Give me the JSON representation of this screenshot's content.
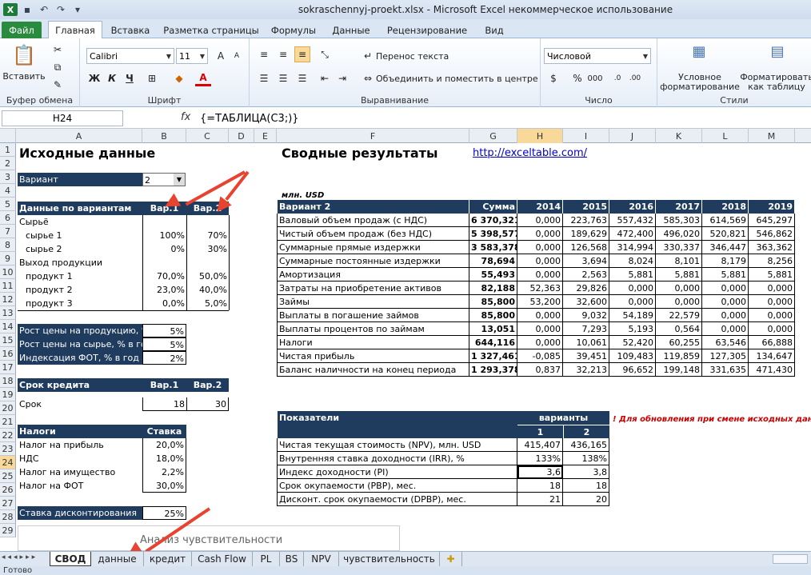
{
  "window": {
    "title": "sokraschennyj-proekt.xlsx  -  Microsoft Excel некоммерческое использование",
    "app_icon": "X"
  },
  "ribbon_tabs": [
    "Файл",
    "Главная",
    "Вставка",
    "Разметка страницы",
    "Формулы",
    "Данные",
    "Рецензирование",
    "Вид"
  ],
  "ribbon": {
    "clipboard": {
      "paste": "Вставить",
      "label": "Буфер обмена"
    },
    "font": {
      "name": "Calibri",
      "size": "11",
      "bold": "Ж",
      "italic": "К",
      "underline": "Ч",
      "color_glyph": "А",
      "label": "Шрифт"
    },
    "alignment": {
      "wrap": "Перенос текста",
      "merge": "Объединить и поместить в центре",
      "label": "Выравнивание"
    },
    "number": {
      "format": "Числовой",
      "percent": "%",
      "thousands": "000",
      "label": "Число"
    },
    "styles": {
      "conditional": "Условное",
      "conditional2": "форматирование",
      "as_table": "Форматировать",
      "as_table2": "как таблицу",
      "label": "Стили"
    }
  },
  "formula_bar": {
    "name_box": "H24",
    "fx": "fx",
    "formula": "{=ТАБЛИЦА(C3;)}"
  },
  "columns": [
    "A",
    "B",
    "C",
    "D",
    "E",
    "F",
    "G",
    "H",
    "I",
    "J",
    "K",
    "L",
    "M"
  ],
  "rows": [
    "1",
    "2",
    "3",
    "4",
    "5",
    "6",
    "7",
    "8",
    "9",
    "10",
    "11",
    "12",
    "13",
    "14",
    "15",
    "16",
    "17",
    "18",
    "19",
    "20",
    "21",
    "22",
    "23",
    "24",
    "25",
    "26",
    "27",
    "28",
    "29"
  ],
  "left": {
    "title": "Исходные данные",
    "variant_label": "Вариант",
    "variant_value": "2",
    "data_hdr": "Данные по вариантам",
    "var1": "Вар.1",
    "var2": "Вар.2",
    "raw": "Сырьё",
    "raw1": "сырье 1",
    "raw1_v1": "100%",
    "raw1_v2": "70%",
    "raw2": "сырье 2",
    "raw2_v1": "0%",
    "raw2_v2": "30%",
    "output": "Выход продукции",
    "p1": "продукт 1",
    "p1_v1": "70,0%",
    "p1_v2": "50,0%",
    "p2": "продукт 2",
    "p2_v1": "23,0%",
    "p2_v2": "40,0%",
    "p3": "продукт 3",
    "p3_v1": "0,0%",
    "p3_v2": "5,0%",
    "g1": "Рост цены на продукцию, % в год",
    "g1_v": "5%",
    "g2": "Рост цены на сырье, % в год",
    "g2_v": "5%",
    "g3": "Индексация ФОТ, % в год",
    "g3_v": "2%",
    "credit_hdr": "Срок кредита",
    "term": "Срок",
    "term_v1": "18",
    "term_v2": "30",
    "tax_hdr": "Налоги",
    "rate_hdr": "Ставка",
    "t1": "Налог на прибыль",
    "t1_v": "20,0%",
    "t2": "НДС",
    "t2_v": "18,0%",
    "t3": "Налог на имущество",
    "t3_v": "2,2%",
    "t4": "Налог на ФОТ",
    "t4_v": "30,0%",
    "disc": "Ставка дисконтирования",
    "disc_v": "25%",
    "textbox": "Анализ чувствительности"
  },
  "right": {
    "title": "Сводные результаты",
    "link": "http://exceltable.com/",
    "unit": "млн. USD",
    "hdr": [
      "Вариант 2",
      "Сумма",
      "2014",
      "2015",
      "2016",
      "2017",
      "2018",
      "2019"
    ],
    "rows": [
      [
        "Валовый объем продаж (с НДС)",
        "6 370,321",
        "0,000",
        "223,763",
        "557,432",
        "585,303",
        "614,569",
        "645,297"
      ],
      [
        "Чистый объем продаж (без НДС)",
        "5 398,577",
        "0,000",
        "189,629",
        "472,400",
        "496,020",
        "520,821",
        "546,862"
      ],
      [
        "Суммарные прямые издержки",
        "3 583,378",
        "0,000",
        "126,568",
        "314,994",
        "330,337",
        "346,447",
        "363,362"
      ],
      [
        "Суммарные постоянные издержки",
        "78,694",
        "0,000",
        "3,694",
        "8,024",
        "8,101",
        "8,179",
        "8,256"
      ],
      [
        "Амортизация",
        "55,493",
        "0,000",
        "2,563",
        "5,881",
        "5,881",
        "5,881",
        "5,881"
      ],
      [
        "Затраты на приобретение активов",
        "82,188",
        "52,363",
        "29,826",
        "0,000",
        "0,000",
        "0,000",
        "0,000"
      ],
      [
        "Займы",
        "85,800",
        "53,200",
        "32,600",
        "0,000",
        "0,000",
        "0,000",
        "0,000"
      ],
      [
        "Выплаты в погашение займов",
        "85,800",
        "0,000",
        "9,032",
        "54,189",
        "22,579",
        "0,000",
        "0,000"
      ],
      [
        "Выплаты процентов по займам",
        "13,051",
        "0,000",
        "7,293",
        "5,193",
        "0,564",
        "0,000",
        "0,000"
      ],
      [
        "Налоги",
        "644,116",
        "0,000",
        "10,061",
        "52,420",
        "60,255",
        "63,546",
        "66,888"
      ],
      [
        "Чистая прибыль",
        "1 327,461",
        "-0,085",
        "39,451",
        "109,483",
        "119,859",
        "127,305",
        "134,647"
      ],
      [
        "Баланс наличности на конец периода",
        "1 293,378",
        "0,837",
        "32,213",
        "96,652",
        "199,148",
        "331,635",
        "471,430"
      ]
    ],
    "ind_hdr": "Показатели",
    "ind_variants": "варианты",
    "ind_1": "1",
    "ind_2": "2",
    "note": "! Для обновления при смене исходных данных н",
    "ind_rows": [
      [
        "Чистая текущая стоимость (NPV), млн. USD",
        "415,407",
        "436,165"
      ],
      [
        "Внутренняя ставка доходности (IRR), %",
        "133%",
        "138%"
      ],
      [
        "Индекс доходности (PI)",
        "3,6",
        "3,8"
      ],
      [
        "Срок окупаемости (PBP), мес.",
        "18",
        "18"
      ],
      [
        "Дисконт. срок окупаемости (DPBP), мес.",
        "21",
        "20"
      ]
    ]
  },
  "sheet_tabs": [
    "СВОД",
    "данные",
    "кредит",
    "Cash Flow",
    "PL",
    "BS",
    "NPV",
    "чувствительность"
  ],
  "status": "Готово",
  "colors": {
    "header_fill": "#1f3b5d",
    "accent_arrow": "#e8432f",
    "excel_green": "#2a8a3e"
  }
}
